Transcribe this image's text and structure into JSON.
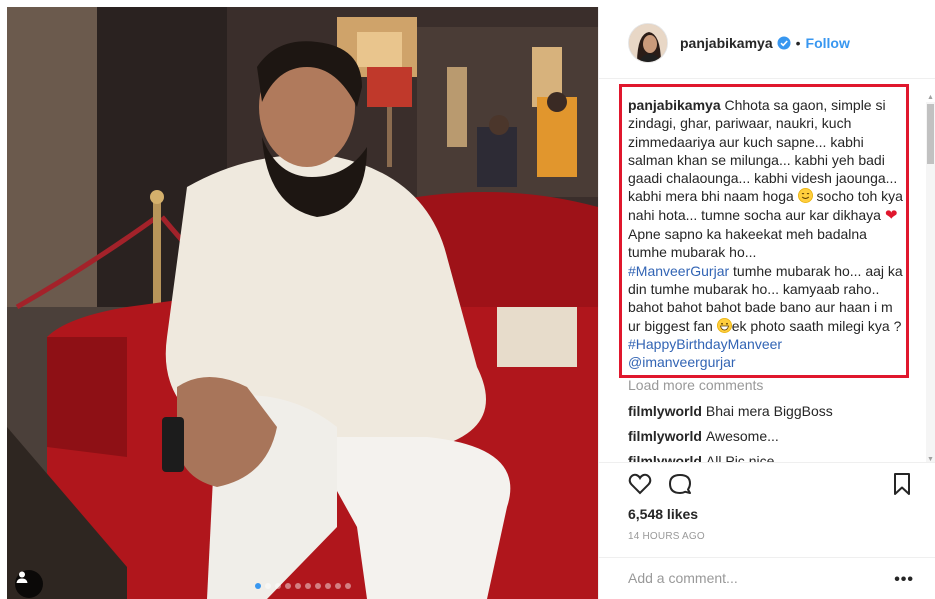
{
  "header": {
    "username": "panjabikamya",
    "separator": "•",
    "follow_label": "Follow"
  },
  "caption": {
    "username": "panjabikamya",
    "text1": " Chhota sa gaon, simple si zindagi, ghar, pariwaar, naukri, kuch zimmedaariya aur kuch sapne... kabhi salman khan se milunga... kabhi yeh badi gaadi chalaounga... kabhi videsh jaounga... kabhi mera bhi naam hoga ",
    "text2": " socho toh kya nahi hota... tumne socha aur kar dikhaya ",
    "text3": " Apne sapno ka hakeekat meh badalna tumhe mubarak ho...",
    "hashtag1": "#ManveerGurjar",
    "text4": " tumhe mubarak ho... aaj ka din tumhe mubarak ho... kamyaab raho.. bahot bahot bahot bade bano aur haan i m ur biggest fan ",
    "text5": "ek photo saath milegi kya ? ",
    "hashtag2": "#HappyBirthdayManveer",
    "mention": "@imanveergurjar"
  },
  "load_more": "Load more comments",
  "comments": [
    {
      "user": "filmlyworld",
      "text": "Bhai mera BiggBoss"
    },
    {
      "user": "filmlyworld",
      "text": "Awesome..."
    },
    {
      "user": "filmlyworld",
      "text": "All Pic nice"
    }
  ],
  "likes": "6,548 likes",
  "timestamp": "14 HOURS AGO",
  "add_comment_placeholder": "Add a comment...",
  "more_label": "•••",
  "carousel": {
    "count": 10,
    "active_index": 0
  },
  "icons": {
    "like": "heart-outline-icon",
    "comment": "speech-bubble-icon",
    "save": "bookmark-icon",
    "tag": "person-tag-icon",
    "verified": "verified-badge-icon"
  },
  "colors": {
    "follow": "#3897f0",
    "hashtag": "#3264b4",
    "highlight_border": "#e0172d",
    "muted": "#999999"
  }
}
